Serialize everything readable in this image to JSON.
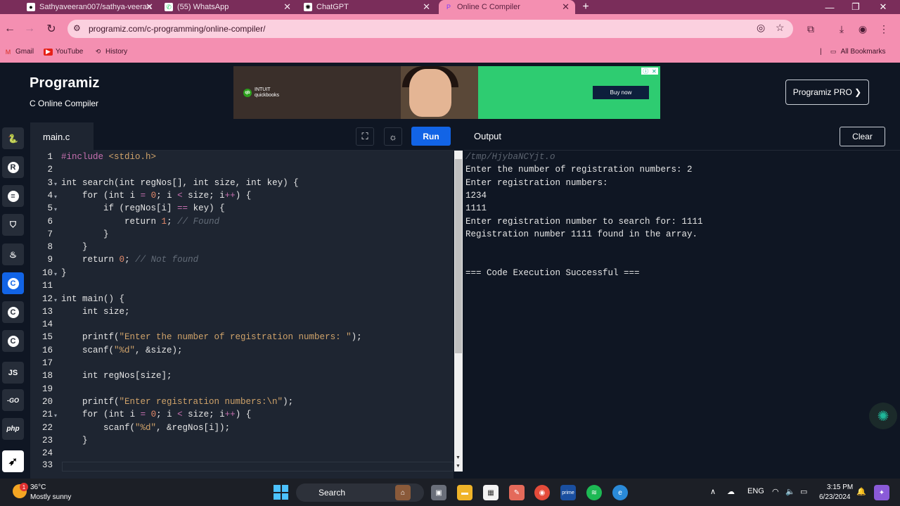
{
  "browser": {
    "tabs": [
      {
        "title": "Sathyaveeran007/sathya-veeran",
        "icon": "github-icon"
      },
      {
        "title": "(55) WhatsApp",
        "icon": "whatsapp-icon"
      },
      {
        "title": "ChatGPT",
        "icon": "chatgpt-icon"
      },
      {
        "title": "Online C Compiler",
        "icon": "programiz-icon"
      }
    ],
    "url": "programiz.com/c-programming/online-compiler/",
    "bookmarks": [
      {
        "label": "Gmail",
        "icon": "gmail-icon"
      },
      {
        "label": "YouTube",
        "icon": "youtube-icon"
      },
      {
        "label": "History",
        "icon": "history-icon"
      }
    ],
    "all_bookmarks": "All Bookmarks"
  },
  "site": {
    "logo": "Programiz",
    "subtitle": "C Online Compiler",
    "pro_button": "Programiz PRO ❯",
    "ad": {
      "brand": "INTUIT quickbooks",
      "cta": "Buy now"
    }
  },
  "rail": [
    {
      "name": "python",
      "glyph": "🐍"
    },
    {
      "name": "r",
      "glyph": "R"
    },
    {
      "name": "sql",
      "glyph": "▤"
    },
    {
      "name": "html",
      "glyph": "5"
    },
    {
      "name": "java",
      "glyph": "☕"
    },
    {
      "name": "c",
      "glyph": "C"
    },
    {
      "name": "cpp",
      "glyph": "C"
    },
    {
      "name": "csharp",
      "glyph": "C"
    },
    {
      "name": "js",
      "glyph": "JS"
    },
    {
      "name": "go",
      "glyph": "-GO"
    },
    {
      "name": "php",
      "glyph": "php"
    },
    {
      "name": "swift",
      "glyph": "✈"
    }
  ],
  "editor": {
    "file_tab": "main.c",
    "run_label": "Run",
    "line_numbers": [
      "1",
      "2",
      "3",
      "4",
      "5",
      "6",
      "7",
      "8",
      "9",
      "10",
      "11",
      "12",
      "13",
      "14",
      "15",
      "16",
      "17",
      "18",
      "19",
      "20",
      "21",
      "22",
      "23",
      "24",
      "33"
    ],
    "fold_lines": [
      "3",
      "4",
      "5",
      "10",
      "12",
      "21"
    ]
  },
  "output": {
    "title": "Output",
    "clear_label": "Clear",
    "lines": [
      "/tmp/HjybaNCYjt.o",
      "Enter the number of registration numbers: 2",
      "Enter registration numbers:",
      "1234",
      "1111",
      "Enter registration number to search for: 1111",
      "Registration number 1111 found in the array.",
      "",
      "",
      "=== Code Execution Successful ==="
    ]
  },
  "taskbar": {
    "temp": "36°C",
    "weather": "Mostly sunny",
    "weather_badge": "1",
    "search": "Search",
    "lang": "ENG",
    "time": "3:15 PM",
    "date": "6/23/2024"
  }
}
